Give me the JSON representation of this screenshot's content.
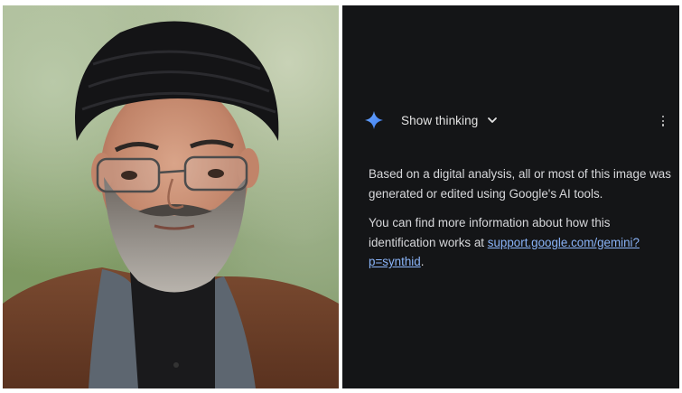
{
  "photo": {
    "alt_description": ""
  },
  "gemini": {
    "sparkle_icon": "sparkle-icon",
    "show_thinking_label": "Show thinking",
    "chevron_icon": "chevron-down-icon",
    "more_icon": "more-vert-icon",
    "paragraph1": "Based on a digital analysis, all or most of this image was generated or edited using Google's AI tools.",
    "paragraph2_prefix": "You can find more information about how this identification works at ",
    "link_label": "support.google.com/gemini?p=synthid",
    "paragraph2_suffix": ".",
    "colors": {
      "background": "#141517",
      "text": "#d7d8db",
      "link": "#8ab4f8",
      "sparkle": "#4a8cf7"
    }
  }
}
